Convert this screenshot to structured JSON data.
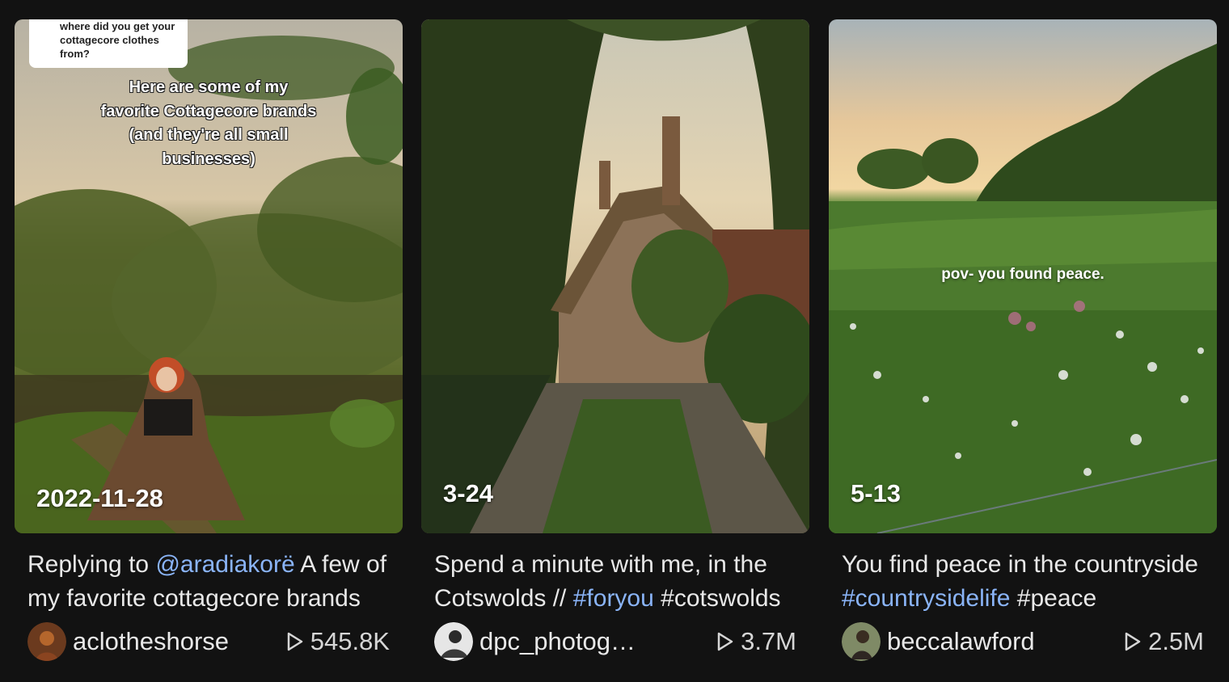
{
  "cards": [
    {
      "date": "2022-11-28",
      "overlay_question": "where did you get your cottagecore clothes from?",
      "overlay_caption": "Here are some of my favorite Cottagecore brands (and they're all small businesses)",
      "desc_prefix": "Replying to ",
      "desc_link": "@aradiakorë",
      "desc_suffix": " A few of my favorite cottagecore brands",
      "author": "aclotheshorse",
      "views": "545.8K"
    },
    {
      "date": "3-24",
      "desc_text": "Spend a minute with me, in the Cotswolds // ",
      "desc_link": "#foryou",
      "desc_suffix": " #cotswolds",
      "author": "dpc_photography",
      "views": "3.7M"
    },
    {
      "date": "5-13",
      "overlay_pov": "pov- you found peace.",
      "desc_text": "You find peace in the countryside ",
      "desc_link": "#countrysidelife",
      "desc_suffix": " #peace",
      "author": "beccalawford",
      "views": "2.5M"
    }
  ],
  "icons": {
    "play": "play-icon"
  }
}
